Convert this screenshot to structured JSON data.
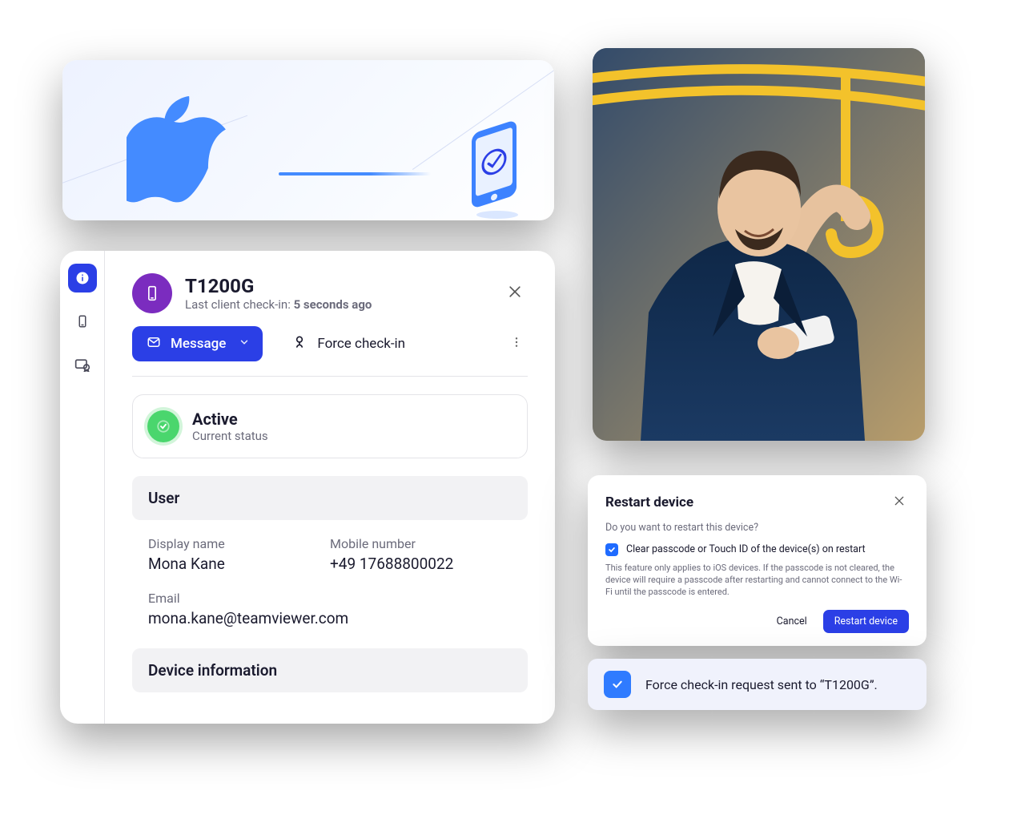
{
  "colors": {
    "primary": "#2B3FE6",
    "accent": "#448BFF",
    "success": "#4AD66D",
    "purple": "#7B2CBF"
  },
  "banner": {
    "logo": "apple-logo",
    "device_icon": "phone-icon"
  },
  "device": {
    "name": "T1200G",
    "checkin_prefix": "Last client check-in: ",
    "checkin_value": "5 seconds ago",
    "actions": {
      "message": "Message",
      "force_checkin": "Force check-in"
    },
    "status": {
      "title": "Active",
      "sub": "Current status"
    },
    "sections": {
      "user": {
        "title": "User",
        "display_name_label": "Display name",
        "display_name": "Mona Kane",
        "mobile_label": "Mobile number",
        "mobile": "+49 17688800022",
        "email_label": "Email",
        "email": "mona.kane@teamviewer.com"
      },
      "device_info": {
        "title": "Device information"
      }
    },
    "rail": [
      {
        "name": "info",
        "active": true
      },
      {
        "name": "device",
        "active": false
      },
      {
        "name": "certificate",
        "active": false
      }
    ]
  },
  "restart_dialog": {
    "title": "Restart device",
    "question": "Do you want to restart this device?",
    "checkbox_label": "Clear passcode or Touch ID of the device(s) on restart",
    "checkbox_checked": true,
    "note": "This feature only applies to iOS devices. If the passcode is not cleared, the device will require a passcode after restarting and cannot connect to the Wi-Fi until the passcode is entered.",
    "cancel": "Cancel",
    "confirm": "Restart device"
  },
  "toast": {
    "message": "Force check-in request sent to “T1200G”."
  }
}
